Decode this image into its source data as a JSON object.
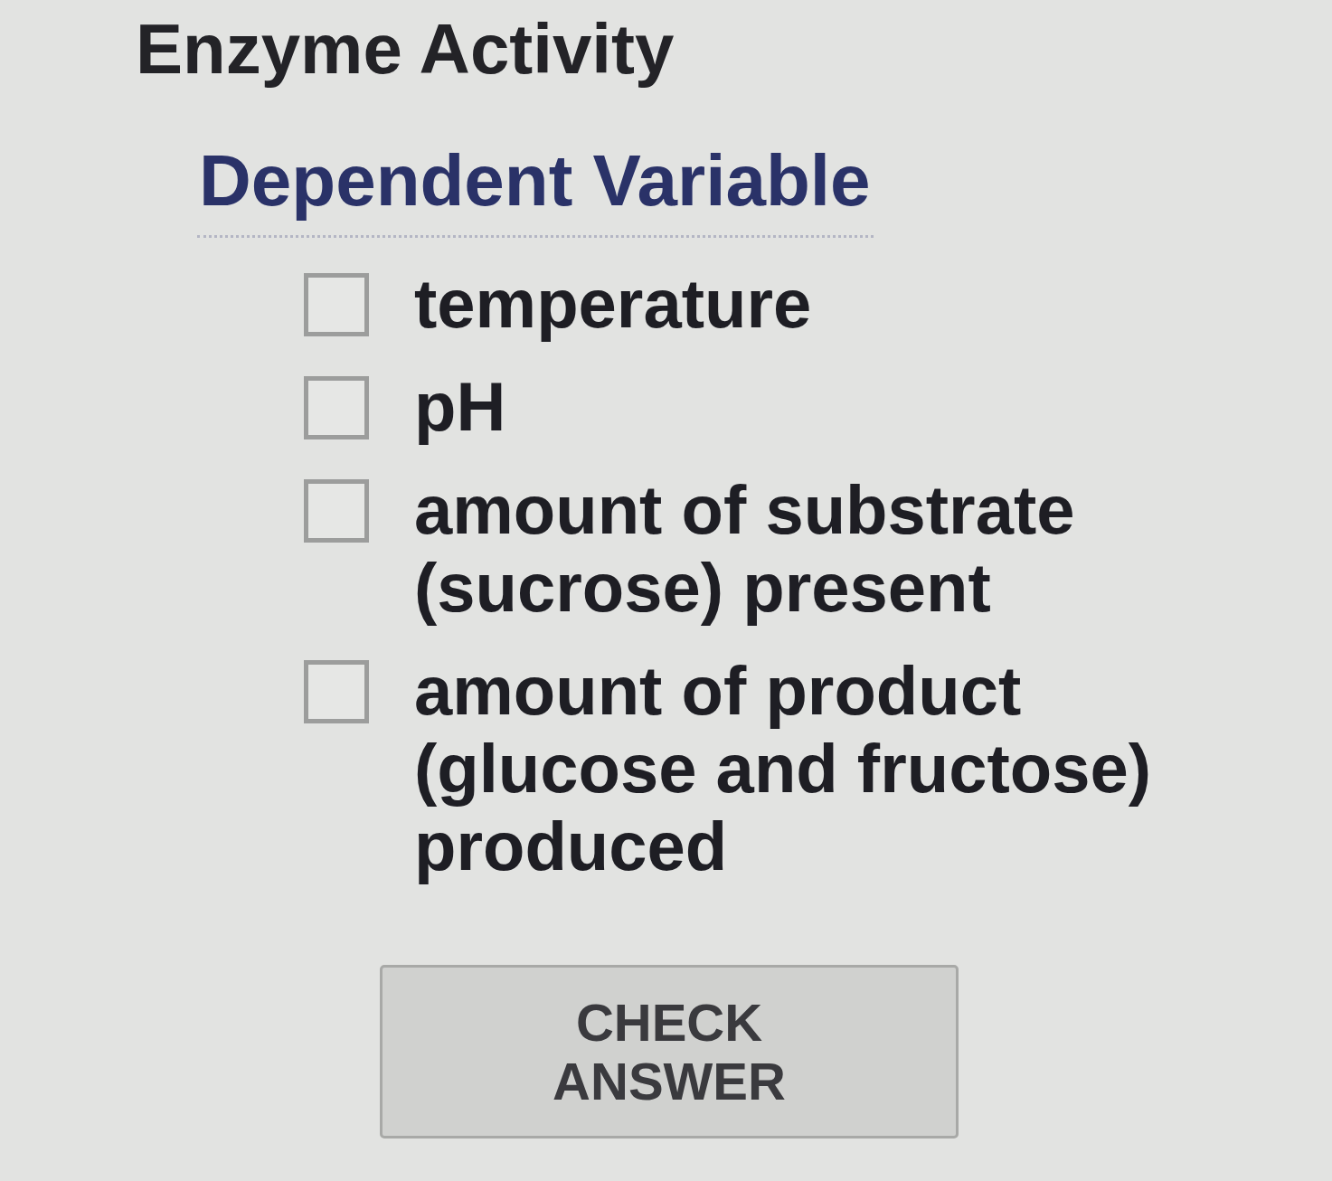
{
  "title": "Enzyme Activity",
  "question": {
    "heading": "Dependent Variable",
    "options": [
      {
        "label": "temperature",
        "checked": false
      },
      {
        "label": "pH",
        "checked": false
      },
      {
        "label": "amount of substrate (sucrose) present",
        "checked": false
      },
      {
        "label": "amount of product (glucose and fructose) produced",
        "checked": false
      }
    ]
  },
  "check_button": {
    "label": "CHECK ANSWER"
  }
}
